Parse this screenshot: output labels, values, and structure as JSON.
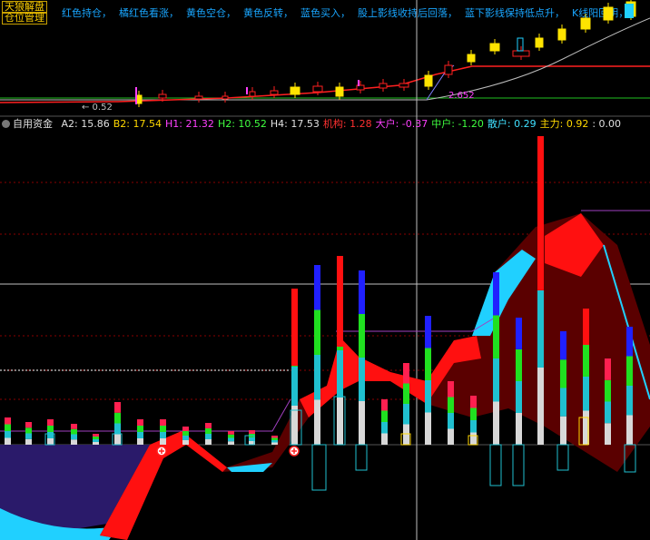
{
  "top_tags": {
    "brand": "天狼解盘",
    "panel": "仓位管理"
  },
  "hints": [
    {
      "text": "红色持仓",
      "color": "#19a6ff"
    },
    {
      "text": "橘红色看涨",
      "color": "#19a6ff"
    },
    {
      "text": "黄色空仓",
      "color": "#19a6ff"
    },
    {
      "text": "黄色反转",
      "color": "#19a6ff"
    },
    {
      "text": "蓝色买入",
      "color": "#19a6ff"
    },
    {
      "text": "股上影线收持后回落",
      "color": "#19a6ff"
    },
    {
      "text": "蓝下影线保持低点升",
      "color": "#19a6ff"
    },
    {
      "text": "K线阳回阴",
      "color": "#19a6ff"
    }
  ],
  "price_labels": {
    "low_value": "0.52",
    "mid_value": "2.652"
  },
  "indicator": {
    "name": "自用资金",
    "items": [
      {
        "label": "A2:",
        "value": "15.86",
        "color": "#e0e0e0"
      },
      {
        "label": "B2:",
        "value": "17.54",
        "color": "#ffd800"
      },
      {
        "label": "H1:",
        "value": "21.32",
        "color": "#ff40ff"
      },
      {
        "label": "H2:",
        "value": "10.52",
        "color": "#40ff40"
      },
      {
        "label": "H4:",
        "value": "17.53",
        "color": "#e0e0e0"
      },
      {
        "label": "机构:",
        "value": "1.28",
        "color": "#ff3030"
      },
      {
        "label": "大户:",
        "value": "-0.37",
        "color": "#ff40ff"
      },
      {
        "label": "中户:",
        "value": "-1.20",
        "color": "#40ff40"
      },
      {
        "label": "散户:",
        "value": "0.29",
        "color": "#40e0ff"
      },
      {
        "label": "主力:",
        "value": "0.92",
        "color": "#ffd800"
      },
      {
        "label": ":",
        "value": "0.00",
        "color": "#e0e0e0"
      }
    ]
  },
  "colors": {
    "bg": "#000000",
    "up_candle": "#ff2020",
    "down_candle": "#ffe400",
    "ma_line": "#ff2020",
    "grid": "#8a0000",
    "crosshair": "#c0c0c0",
    "area_red": "#ff1010",
    "area_dark": "#5a0000",
    "area_cyan": "#20d0ff",
    "area_navy": "#2a1a6a"
  },
  "icons": [
    "gear-icon",
    "plus-circle-icon"
  ]
}
